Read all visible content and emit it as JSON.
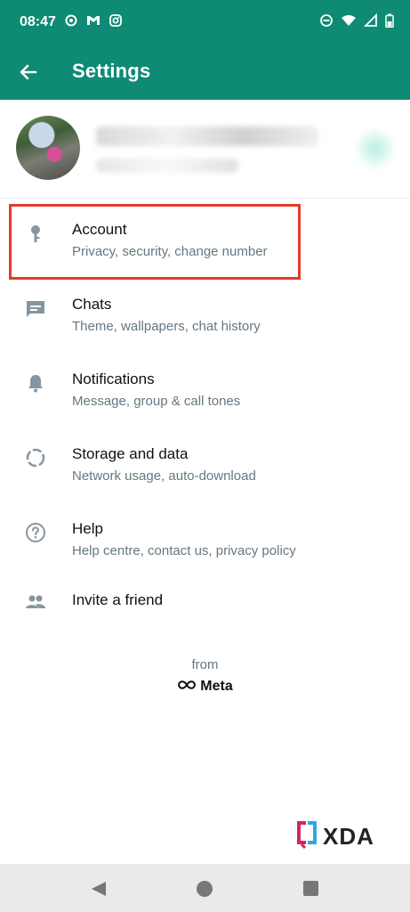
{
  "status_bar": {
    "time": "08:47",
    "left_icons": [
      "threads-icon",
      "gmail-icon",
      "instagram-icon"
    ],
    "right_icons": [
      "dnd-icon",
      "wifi-icon",
      "signal-icon",
      "battery-icon"
    ]
  },
  "app_bar": {
    "title": "Settings",
    "background": "#0f8a74"
  },
  "menu": {
    "items": [
      {
        "title": "Account",
        "subtitle": "Privacy, security, change number",
        "icon": "key-icon"
      },
      {
        "title": "Chats",
        "subtitle": "Theme, wallpapers, chat history",
        "icon": "chat-icon"
      },
      {
        "title": "Notifications",
        "subtitle": "Message, group & call tones",
        "icon": "bell-icon"
      },
      {
        "title": "Storage and data",
        "subtitle": "Network usage, auto-download",
        "icon": "storage-icon"
      },
      {
        "title": "Help",
        "subtitle": "Help centre, contact us, privacy policy",
        "icon": "help-icon"
      },
      {
        "title": "Invite a friend",
        "icon": "people-icon"
      }
    ]
  },
  "footer": {
    "from": "from",
    "meta": "Meta"
  },
  "watermark": {
    "text": "XDA"
  },
  "colors": {
    "accent": "#0f8a74",
    "highlight": "#e53a2a",
    "icon": "#8696a0",
    "secondary_text": "#667781"
  }
}
